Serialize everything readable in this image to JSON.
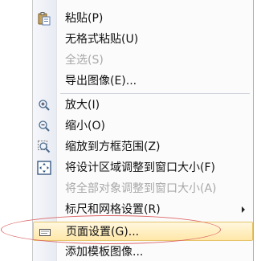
{
  "menu": {
    "items": [
      {
        "label": "粘贴(P)",
        "mnemonic": "P",
        "icon": "clipboard-paste-icon",
        "disabled": false
      },
      {
        "label": "无格式粘贴(U)",
        "mnemonic": "U",
        "icon": "",
        "disabled": false
      },
      {
        "label": "全选(S)",
        "mnemonic": "S",
        "icon": "",
        "disabled": true
      },
      {
        "label": "导出图像(E)...",
        "mnemonic": "E",
        "icon": "",
        "disabled": false
      },
      {
        "label": "放大(I)",
        "mnemonic": "I",
        "icon": "zoom-in-icon",
        "disabled": false
      },
      {
        "label": "缩小(O)",
        "mnemonic": "O",
        "icon": "zoom-out-icon",
        "disabled": false
      },
      {
        "label": "缩放到方框范围(Z)",
        "mnemonic": "Z",
        "icon": "zoom-region-icon",
        "disabled": false
      },
      {
        "label": "将设计区域调整到窗口大小(F)",
        "mnemonic": "F",
        "icon": "fit-to-window-icon",
        "disabled": false
      },
      {
        "label": "将全部对象调整到窗口大小(A)",
        "mnemonic": "A",
        "icon": "",
        "disabled": true
      },
      {
        "label": "标尺和网格设置(R)",
        "mnemonic": "R",
        "icon": "",
        "disabled": false,
        "submenu": true
      },
      {
        "label": "页面设置(G)...",
        "mnemonic": "G",
        "icon": "page-setup-icon",
        "disabled": false,
        "highlighted": true
      },
      {
        "label": "添加模板图像...",
        "mnemonic": "",
        "icon": "",
        "disabled": false
      }
    ]
  },
  "annotation": {
    "color": "#dd6a6a",
    "shape": "ellipse"
  },
  "colors": {
    "highlight_border": "#e6c46a",
    "highlight_fill": "#ffe7a8",
    "disabled_text": "#a8a8a8"
  }
}
